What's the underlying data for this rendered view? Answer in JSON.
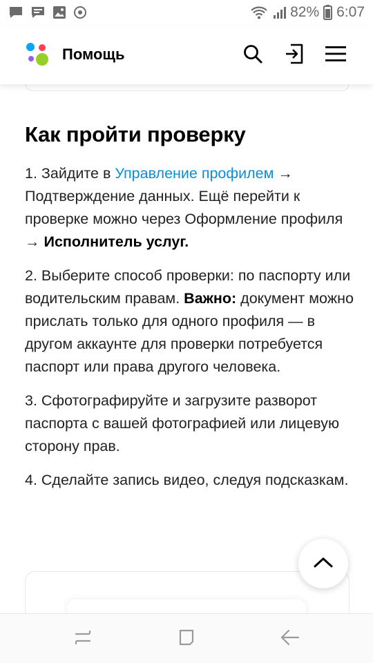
{
  "status_bar": {
    "battery": "82%",
    "time": "6:07",
    "icons": [
      "message-icon",
      "chat-icon",
      "image-icon",
      "sync-icon",
      "wifi-icon",
      "signal-icon",
      "battery-icon"
    ]
  },
  "header": {
    "title": "Помощь",
    "logo_colors": [
      "#0aa5f5",
      "#ff4053",
      "#965eeb",
      "#97cf26"
    ],
    "icons": [
      "search-icon",
      "logout-icon",
      "menu-icon"
    ]
  },
  "article": {
    "title": "Как пройти проверку",
    "step1": {
      "prefix": "1. Зайдите в ",
      "link": "Управление профилем",
      "middle": " → Подтверждение данных. Ещё перейти к проверке можно через Оформление профиля → ",
      "bold": "Исполнитель услуг."
    },
    "step2": {
      "prefix": "2. Выберите способ проверки: по паспорту или водительским правам. ",
      "bold": "Важно:",
      "suffix": " документ можно прислать только для одного профиля — в другом аккаунте для проверки потребуется паспорт или права другого человека."
    },
    "step3": "3. Сфотографируйте и загрузите разворот паспорта с вашей фотографией или лицевую сторону прав.",
    "step4": "4. Сделайте запись видео, следуя подсказкам."
  },
  "colors": {
    "link": "#0a8ed6",
    "text": "#222222"
  },
  "nav_bar": {
    "icons": [
      "recents-icon",
      "home-icon",
      "back-icon"
    ]
  }
}
